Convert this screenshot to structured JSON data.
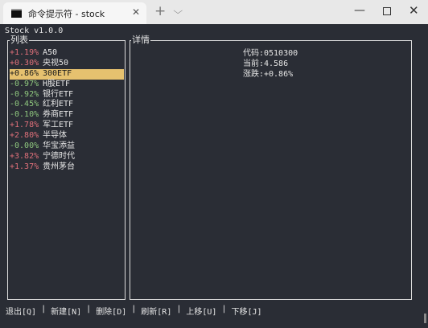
{
  "window": {
    "tab_title": "命令提示符 - stock",
    "new_tab_symbol": "+",
    "dropdown_symbol": "⌵",
    "close_tab_symbol": "✕",
    "minimize_symbol": "—",
    "close_symbol": "✕",
    "icons": [
      "terminal-icon",
      "close-icon",
      "plus-icon",
      "chevron-down-icon",
      "minimize-icon",
      "maximize-icon",
      "window-close-icon"
    ]
  },
  "app": {
    "title": "Stock v1.0.0"
  },
  "list_panel": {
    "label": "列表",
    "selected_index": 2,
    "items": [
      {
        "change": "+1.19%",
        "name": "A50",
        "direction": "up"
      },
      {
        "change": "+0.30%",
        "name": "央视50",
        "direction": "up"
      },
      {
        "change": "+0.86%",
        "name": "300ETF",
        "direction": "up"
      },
      {
        "change": "-0.97%",
        "name": "H股ETF",
        "direction": "down"
      },
      {
        "change": "-0.92%",
        "name": "银行ETF",
        "direction": "down"
      },
      {
        "change": "-0.45%",
        "name": "红利ETF",
        "direction": "down"
      },
      {
        "change": "-0.10%",
        "name": "券商ETF",
        "direction": "down"
      },
      {
        "change": "+1.78%",
        "name": "军工ETF",
        "direction": "up"
      },
      {
        "change": "+2.80%",
        "name": "半导体",
        "direction": "up"
      },
      {
        "change": "-0.00%",
        "name": "华宝添益",
        "direction": "down"
      },
      {
        "change": "+3.82%",
        "name": "宁德时代",
        "direction": "up"
      },
      {
        "change": "+1.37%",
        "name": "贵州茅台",
        "direction": "up"
      }
    ]
  },
  "detail_panel": {
    "label": "详情",
    "code_label": "代码:",
    "code_value": "0510300",
    "price_label": "当前:",
    "price_value": "4.586",
    "change_label": "涨跌:",
    "change_value": "+0.86%"
  },
  "hotkeys": [
    {
      "label": "退出[Q]",
      "name": "quit"
    },
    {
      "label": "新建[N]",
      "name": "new"
    },
    {
      "label": "删除[D]",
      "name": "delete"
    },
    {
      "label": "刷新[R]",
      "name": "refresh"
    },
    {
      "label": "上移[U]",
      "name": "move-up"
    },
    {
      "label": "下移[J]",
      "name": "move-down"
    }
  ],
  "hotkey_separator": "|",
  "colors": {
    "up": "#e0707a",
    "down": "#8fc77e",
    "selection": "#e6c16f",
    "background": "#2a2d35"
  }
}
